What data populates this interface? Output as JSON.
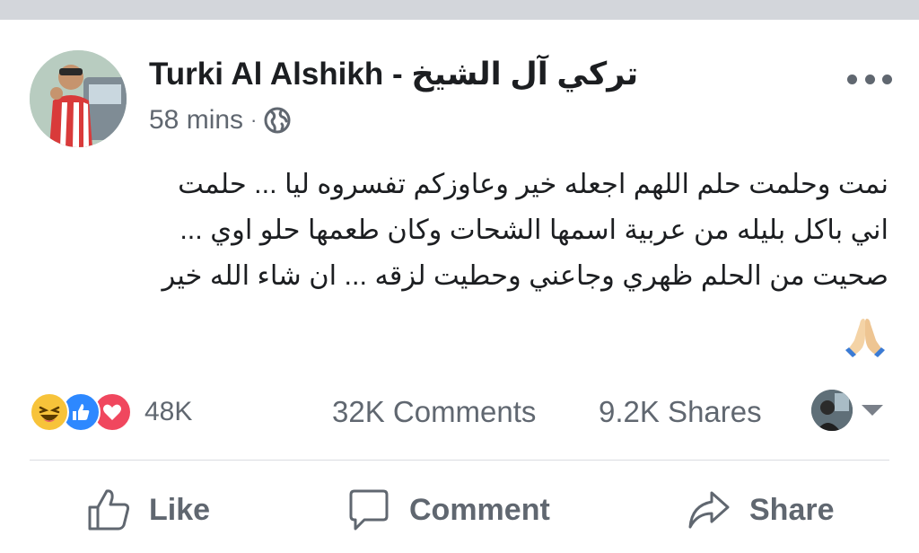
{
  "post": {
    "author": "Turki Al Alshikh - تركي آل الشيخ",
    "time": "58 mins",
    "separator": "·",
    "privacy_icon": "globe-icon",
    "more_icon": "more-options-icon",
    "lines": [
      "نمت وحلمت حلم اللهم اجعله خير وعاوزكم تفسروه ليا ... حلمت",
      "اني باكل بليله من عربية اسمها الشحات وكان طعمها حلو اوي ...",
      "صحيت من الحلم ظهري وجاعني وحطيت لزقه ... ان شاء الله خير"
    ],
    "emoji": "folded-hands-emoji"
  },
  "stats": {
    "reaction_icons": [
      "haha-icon",
      "like-icon",
      "love-icon"
    ],
    "reactions_count": "48K",
    "comments": "32K Comments",
    "shares": "9.2K Shares"
  },
  "actions": {
    "like": "Like",
    "comment": "Comment",
    "share": "Share"
  },
  "colors": {
    "secondary_text": "#606770",
    "like_blue": "#2d88ff",
    "love_red": "#f0475e",
    "haha_yellow": "#f7c33a"
  }
}
